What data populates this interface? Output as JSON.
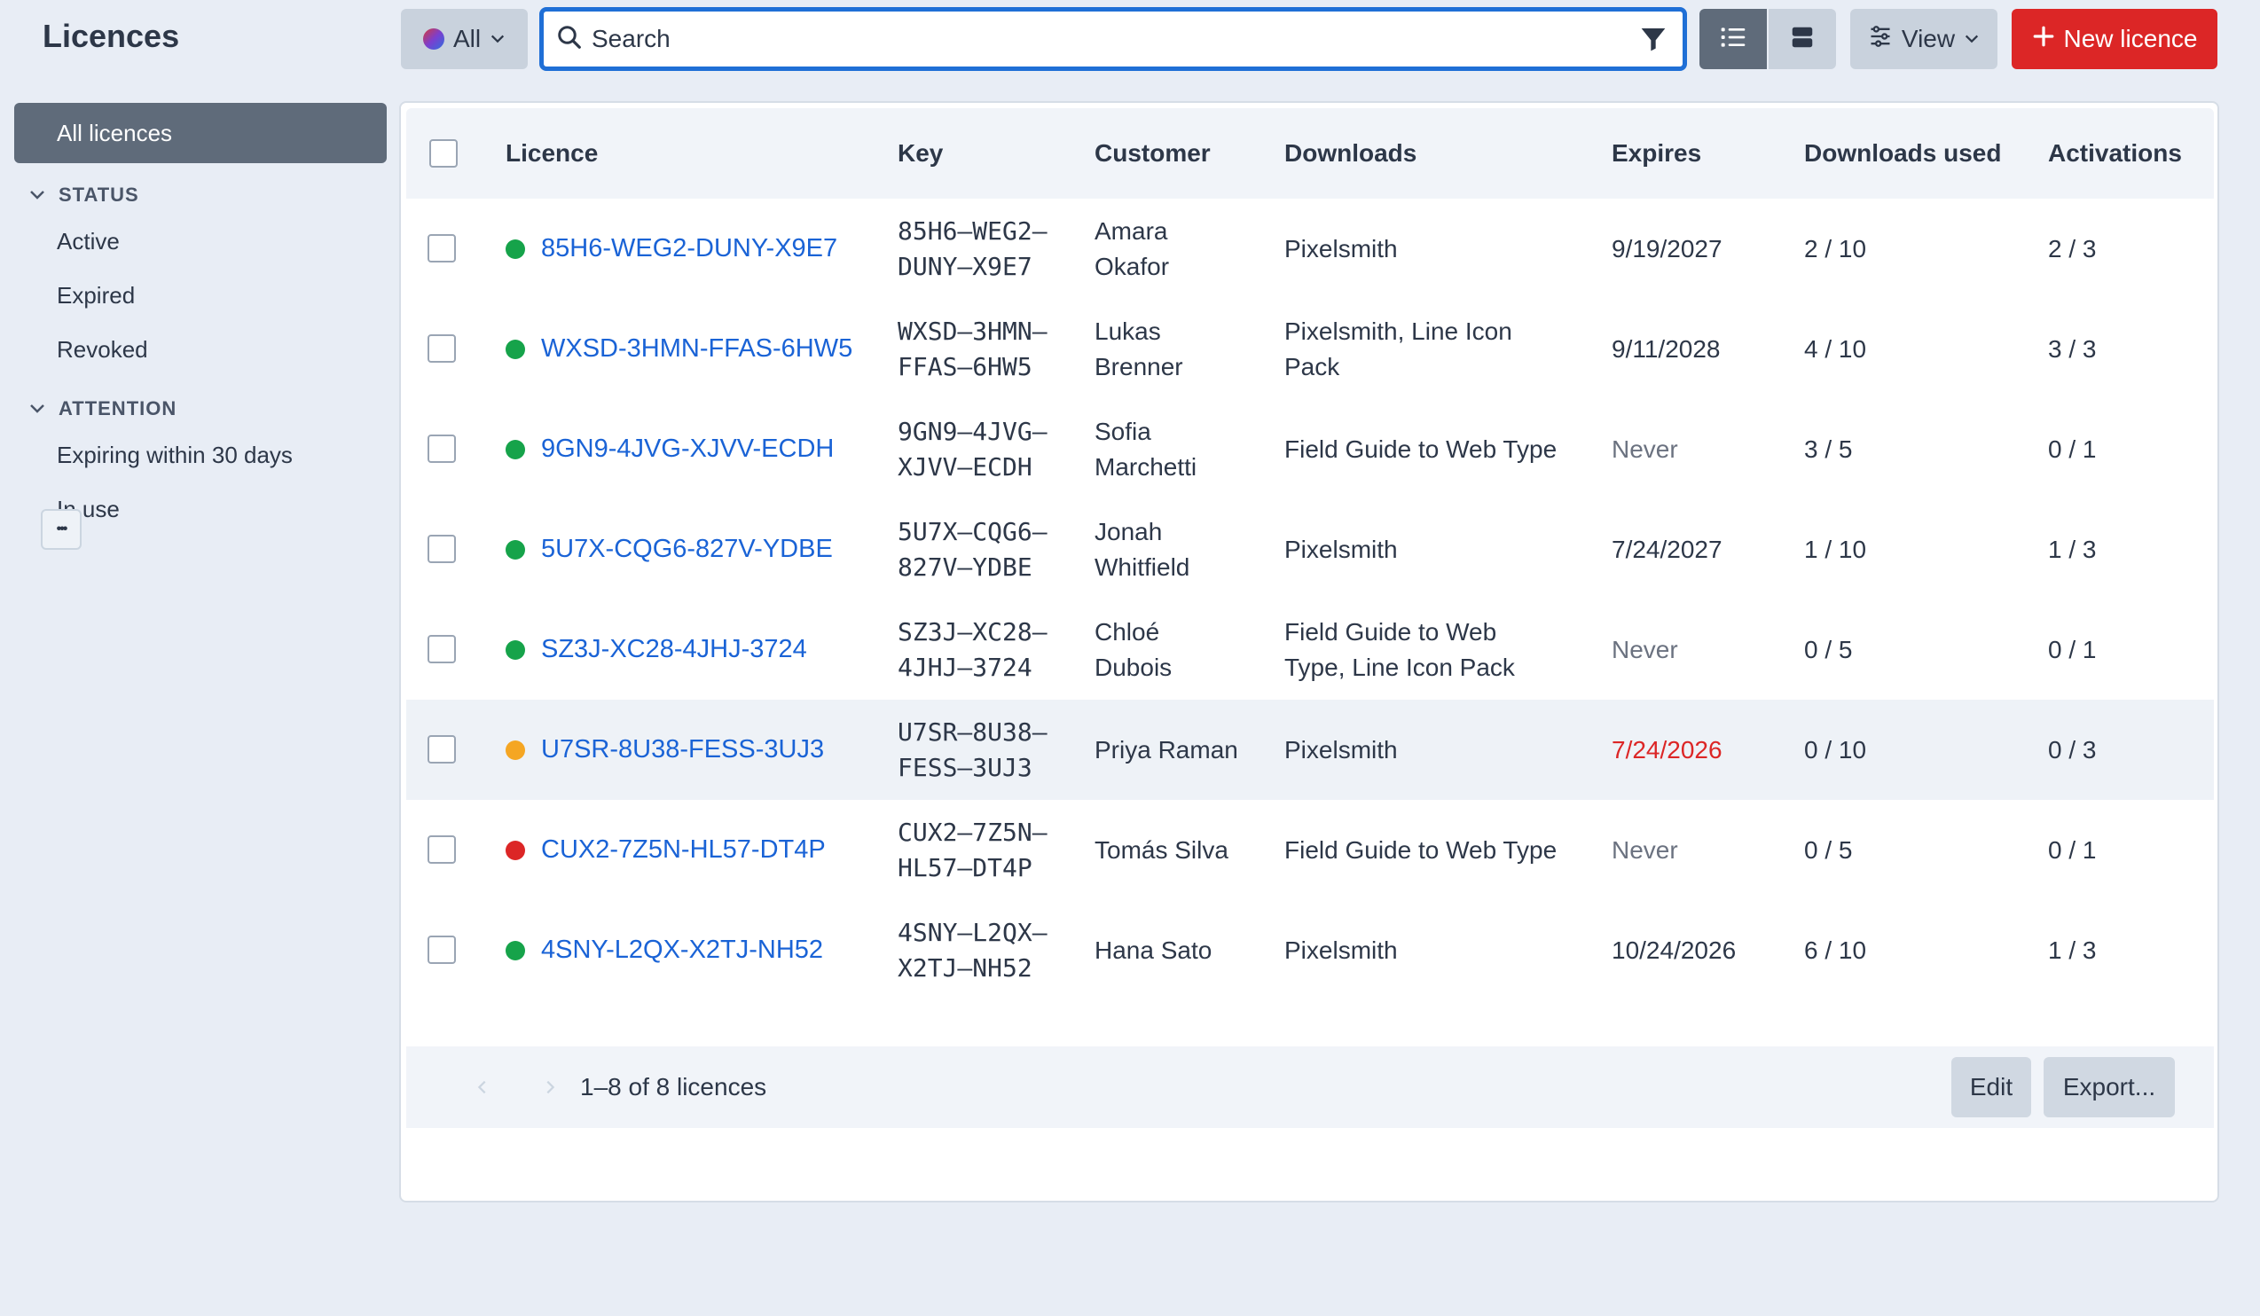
{
  "app": {
    "title": "Licences"
  },
  "sidebar": {
    "all_label": "All licences",
    "sections": [
      {
        "title": "STATUS",
        "items": [
          "Active",
          "Expired",
          "Revoked"
        ]
      },
      {
        "title": "ATTENTION",
        "items": [
          "Expiring within 30 days",
          "In use"
        ]
      }
    ],
    "more_label": "•••"
  },
  "toolbar": {
    "all_label": "All",
    "search_placeholder": "Search",
    "view_label": "View",
    "new_label": "New licence"
  },
  "table": {
    "columns": [
      "Licence",
      "Key",
      "Customer",
      "Downloads",
      "Expires",
      "Downloads used",
      "Activations"
    ],
    "rows": [
      {
        "status": "active",
        "status_color": "#16a34a",
        "licence": "85H6-WEG2-DUNY-X9E7",
        "key_line1": "85H6–WEG2–",
        "key_line2": "DUNY–X9E7",
        "customer_line1": "Amara",
        "customer_line2": "Okafor",
        "downloads_line1": "Pixelsmith",
        "downloads_line2": "",
        "expires": "9/19/2027",
        "expires_style": "normal",
        "downloads_used": "2 / 10",
        "activations": "2 / 3"
      },
      {
        "status": "active",
        "status_color": "#16a34a",
        "licence": "WXSD-3HMN-FFAS-6HW5",
        "key_line1": "WXSD–3HMN–",
        "key_line2": "FFAS–6HW5",
        "customer_line1": "Lukas",
        "customer_line2": "Brenner",
        "downloads_line1": "Pixelsmith, Line Icon",
        "downloads_line2": "Pack",
        "expires": "9/11/2028",
        "expires_style": "normal",
        "downloads_used": "4 / 10",
        "activations": "3 / 3"
      },
      {
        "status": "active",
        "status_color": "#16a34a",
        "licence": "9GN9-4JVG-XJVV-ECDH",
        "key_line1": "9GN9–4JVG–",
        "key_line2": "XJVV–ECDH",
        "customer_line1": "Sofia",
        "customer_line2": "Marchetti",
        "downloads_line1": "Field Guide to Web Type",
        "downloads_line2": "",
        "expires": "Never",
        "expires_style": "muted",
        "downloads_used": "3 / 5",
        "activations": "0 / 1"
      },
      {
        "status": "active",
        "status_color": "#16a34a",
        "licence": "5U7X-CQG6-827V-YDBE",
        "key_line1": "5U7X–CQG6–",
        "key_line2": "827V–YDBE",
        "customer_line1": "Jonah",
        "customer_line2": "Whitfield",
        "downloads_line1": "Pixelsmith",
        "downloads_line2": "",
        "expires": "7/24/2027",
        "expires_style": "normal",
        "downloads_used": "1 / 10",
        "activations": "1 / 3"
      },
      {
        "status": "active",
        "status_color": "#16a34a",
        "licence": "SZ3J-XC28-4JHJ-3724",
        "key_line1": "SZ3J–XC28–",
        "key_line2": "4JHJ–3724",
        "customer_line1": "Chloé",
        "customer_line2": "Dubois",
        "downloads_line1": "Field Guide to Web",
        "downloads_line2": "Type, Line Icon Pack",
        "expires": "Never",
        "expires_style": "muted",
        "downloads_used": "0 / 5",
        "activations": "0 / 1"
      },
      {
        "status": "expired",
        "status_color": "#f5a623",
        "licence": "U7SR-8U38-FESS-3UJ3",
        "key_line1": "U7SR–8U38–",
        "key_line2": "FESS–3UJ3",
        "customer_line1": "Priya Raman",
        "customer_line2": "",
        "downloads_line1": "Pixelsmith",
        "downloads_line2": "",
        "expires": "7/24/2026",
        "expires_style": "danger",
        "downloads_used": "0 / 10",
        "activations": "0 / 3"
      },
      {
        "status": "revoked",
        "status_color": "#dc2626",
        "licence": "CUX2-7Z5N-HL57-DT4P",
        "key_line1": "CUX2–7Z5N–",
        "key_line2": "HL57–DT4P",
        "customer_line1": "Tomás Silva",
        "customer_line2": "",
        "downloads_line1": "Field Guide to Web Type",
        "downloads_line2": "",
        "expires": "Never",
        "expires_style": "muted",
        "downloads_used": "0 / 5",
        "activations": "0 / 1"
      },
      {
        "status": "active",
        "status_color": "#16a34a",
        "licence": "4SNY-L2QX-X2TJ-NH52",
        "key_line1": "4SNY–L2QX–",
        "key_line2": "X2TJ–NH52",
        "customer_line1": "Hana Sato",
        "customer_line2": "",
        "downloads_line1": "Pixelsmith",
        "downloads_line2": "",
        "expires": "10/24/2026",
        "expires_style": "warning",
        "downloads_used": "6 / 10",
        "activations": "1 / 3"
      }
    ],
    "highlighted_row": 5
  },
  "footer": {
    "count_text": "1–8 of 8 licences",
    "edit_label": "Edit",
    "export_label": "Export..."
  },
  "colors": {
    "accent": "#1f6fd6",
    "danger": "#dc2626",
    "active": "#16a34a",
    "warning": "#f5a623"
  }
}
